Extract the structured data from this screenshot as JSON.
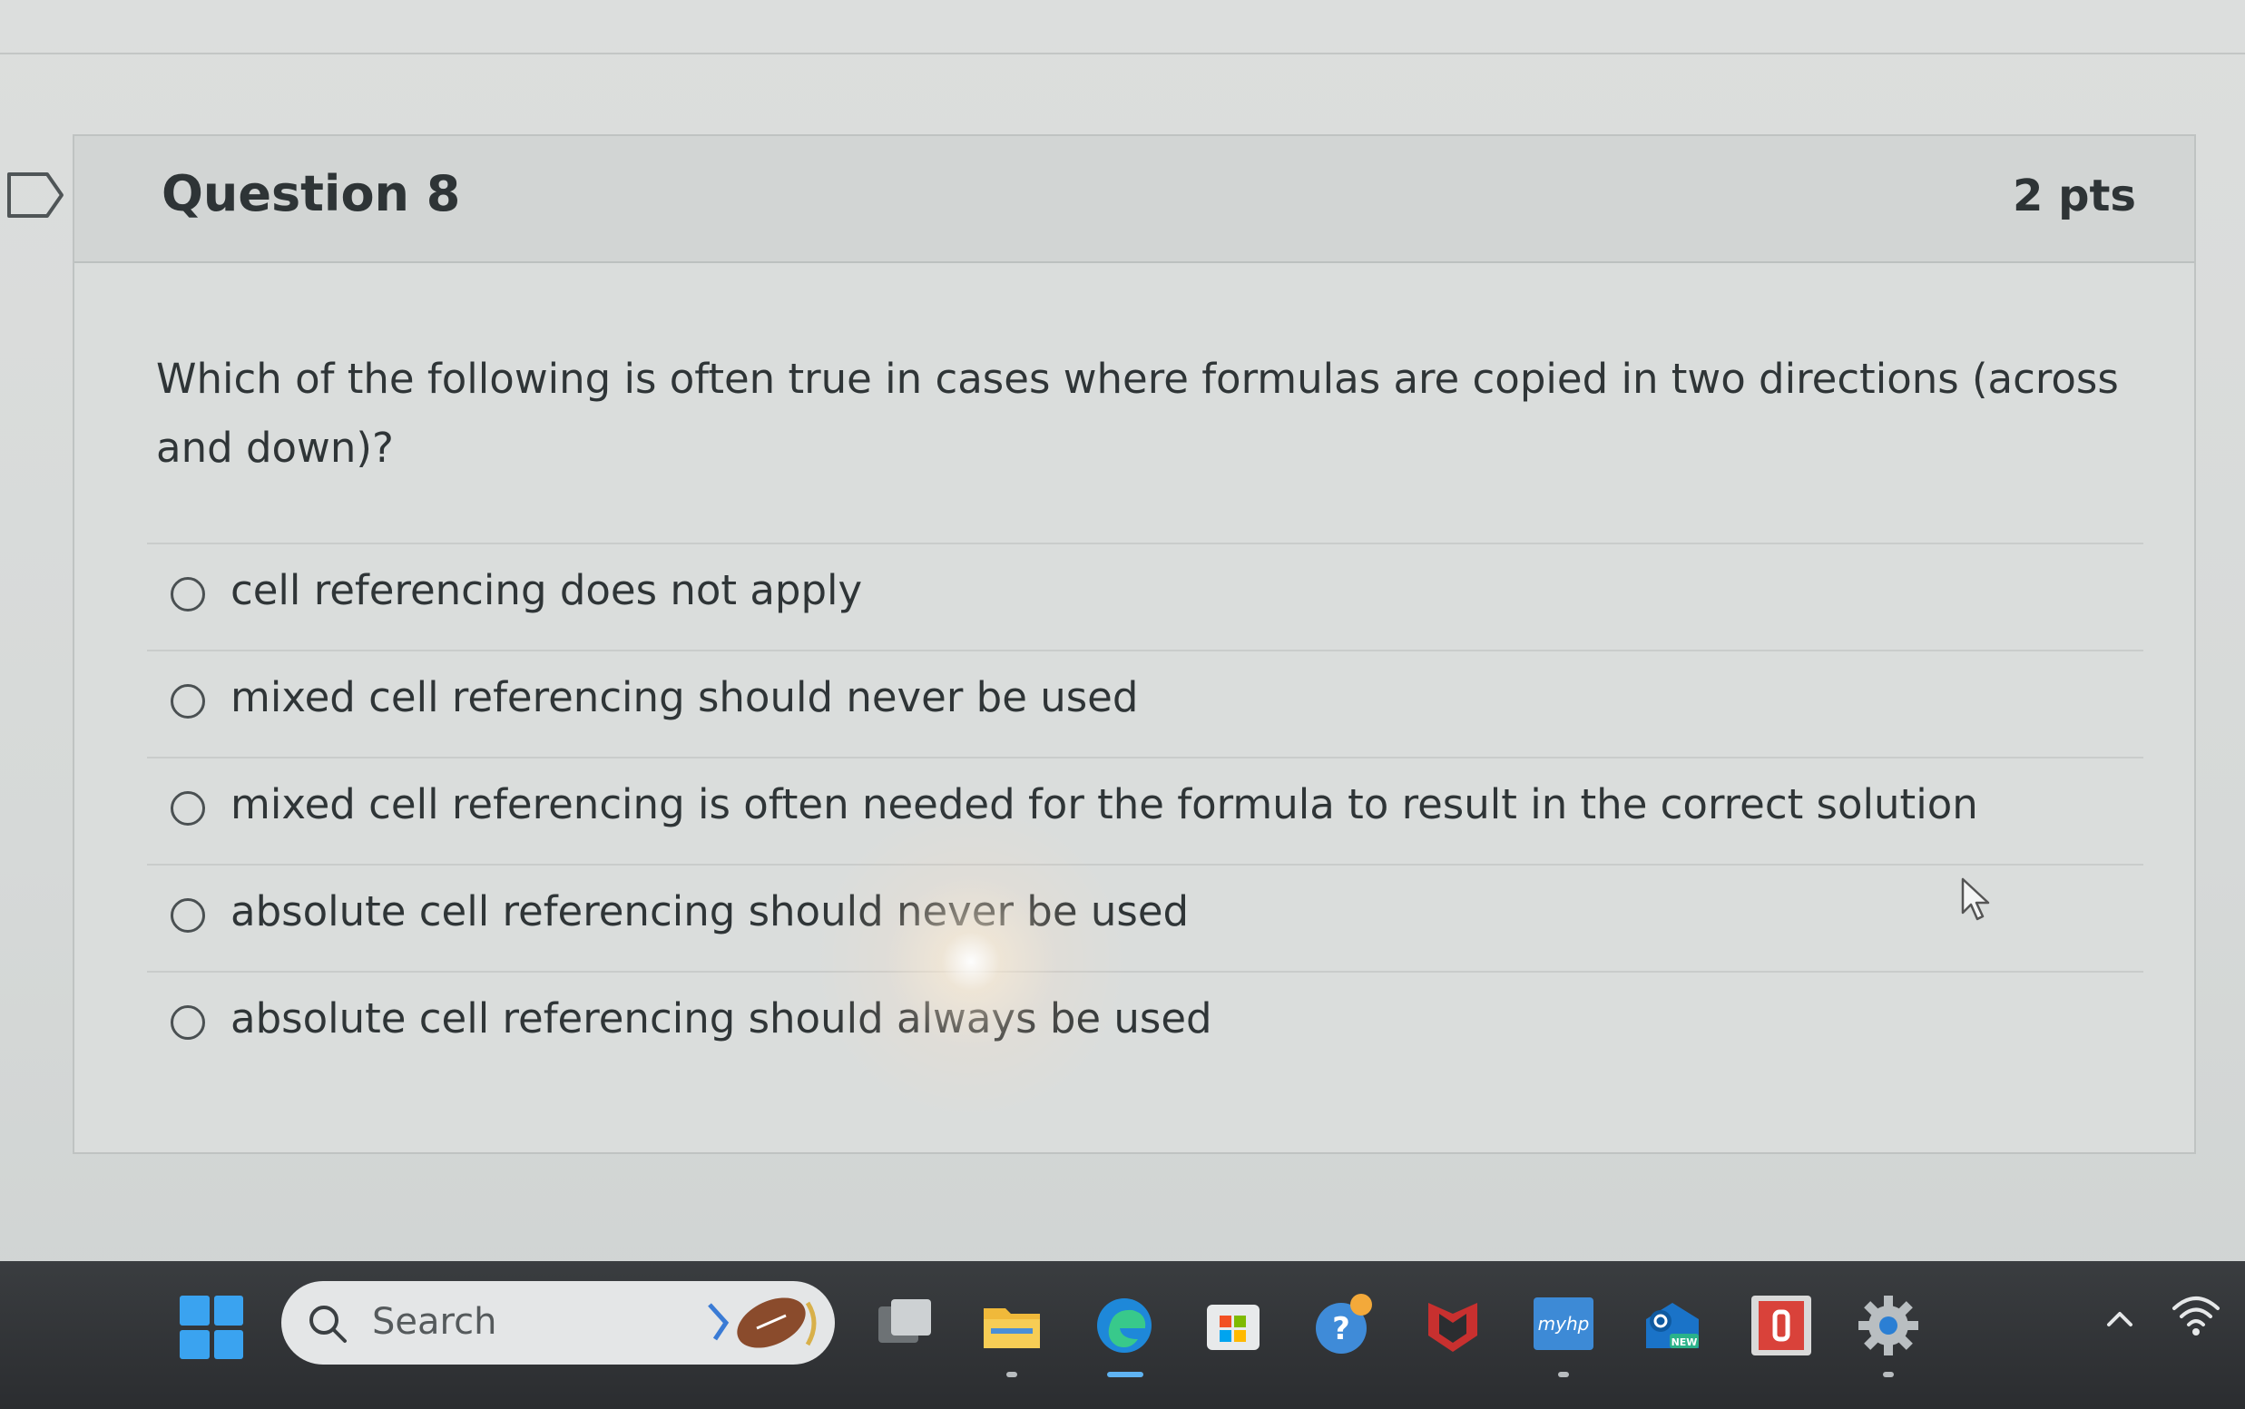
{
  "question": {
    "title": "Question 8",
    "points": "2 pts",
    "text": "Which of the following is often true in cases where formulas are copied in two directions (across and down)?"
  },
  "answers": [
    {
      "label": "cell referencing does not apply",
      "selected": false
    },
    {
      "label": "mixed cell referencing should never be used",
      "selected": false
    },
    {
      "label": "mixed cell referencing is often needed for the formula to result in the correct solution",
      "selected": false
    },
    {
      "label": "absolute cell referencing should never be used",
      "selected": false
    },
    {
      "label": "absolute cell referencing should always be used",
      "selected": false
    }
  ],
  "taskbar": {
    "search_label": "Search",
    "icons": [
      "windows-start-icon",
      "task-view-icon",
      "file-explorer-icon",
      "edge-icon",
      "microsoft-store-icon",
      "help-icon",
      "mcafee-icon",
      "myhp-icon",
      "outlook-new-icon",
      "office-icon",
      "settings-icon"
    ],
    "outlook_badge": "NEW",
    "myhp_label": "myhp"
  },
  "colors": {
    "accent_blue": "#3aa3f0",
    "text_dark": "#2f3537",
    "taskbar_bg": "#2b2d30"
  }
}
